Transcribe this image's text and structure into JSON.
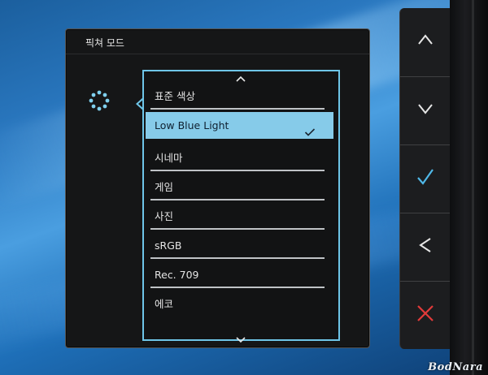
{
  "menu": {
    "title": "픽쳐 모드",
    "icon": "picture-mode-icon",
    "items": [
      {
        "label": "표준 색상",
        "selected": false
      },
      {
        "label": "Low Blue Light",
        "selected": true
      },
      {
        "label": "시네마",
        "selected": false
      },
      {
        "label": "게임",
        "selected": false
      },
      {
        "label": "사진",
        "selected": false
      },
      {
        "label": "sRGB",
        "selected": false
      },
      {
        "label": "Rec. 709",
        "selected": false
      },
      {
        "label": "에코",
        "selected": false
      }
    ],
    "highlight_color": "#86cbe9",
    "border_color": "#6ec5e8"
  },
  "controls": [
    {
      "name": "up",
      "icon": "chevron-up-icon"
    },
    {
      "name": "down",
      "icon": "chevron-down-icon"
    },
    {
      "name": "confirm",
      "icon": "check-icon",
      "color": "#4fb8e8"
    },
    {
      "name": "back",
      "icon": "chevron-left-icon"
    },
    {
      "name": "close",
      "icon": "close-icon",
      "color": "#e23a3a"
    }
  ],
  "watermark": "BodNara"
}
